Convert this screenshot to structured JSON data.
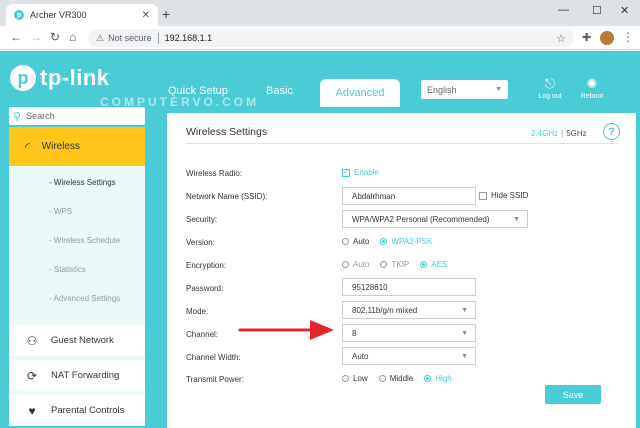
{
  "browser": {
    "tab_title": "Archer VR300",
    "url_secure_label": "Not secure",
    "url": "192.168.1.1"
  },
  "header": {
    "logo_text": "tp-link",
    "watermark": "COMPUTERVO.COM",
    "tabs": [
      "Quick Setup",
      "Basic",
      "Advanced"
    ],
    "language": "English",
    "logout_label": "Log out",
    "reboot_label": "Reboot"
  },
  "sidebar": {
    "search_placeholder": "Search",
    "active_item": "Wireless",
    "subitems": [
      "- Wireless Settings",
      "- WPS",
      "- Wireless Schedule",
      "- Statistics",
      "- Advanced Settings"
    ],
    "items": [
      "Guest Network",
      "NAT Forwarding",
      "Parental Controls"
    ]
  },
  "panel": {
    "title": "Wireless Settings",
    "band_24": "2.4GHz",
    "band_5": "5GHz",
    "help_glyph": "?",
    "fields": {
      "radio_label": "Wireless Radio:",
      "radio_value": "Enable",
      "ssid_label": "Network Name (SSID):",
      "ssid_value": "Abdalrhman",
      "hide_ssid": "Hide SSID",
      "security_label": "Security:",
      "security_value": "WPA/WPA2 Personal (Recommended)",
      "version_label": "Version:",
      "version_options": [
        "Auto",
        "WPA2-PSK"
      ],
      "encryption_label": "Encryption:",
      "encryption_options": [
        "Auto",
        "TKIP",
        "AES"
      ],
      "password_label": "Password:",
      "password_value": "95128610",
      "mode_label": "Mode:",
      "mode_value": "802.11b/g/n mixed",
      "channel_label": "Channel:",
      "channel_value": "8",
      "width_label": "Channel Width:",
      "width_value": "Auto",
      "power_label": "Transmit Power:",
      "power_options": [
        "Low",
        "Middle",
        "High"
      ]
    },
    "save_label": "Save"
  },
  "colors": {
    "brand": "#4acbd6",
    "active_menu": "#ffc619",
    "arrow": "#e3262b"
  }
}
